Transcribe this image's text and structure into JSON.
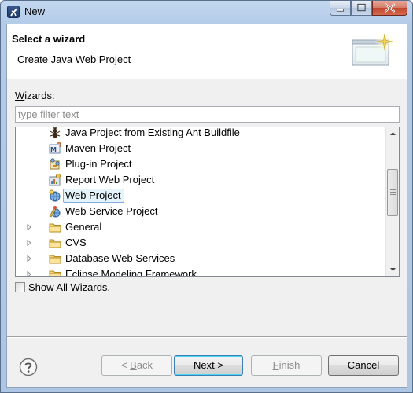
{
  "window": {
    "title": "New"
  },
  "banner": {
    "title": "Select a wizard",
    "description": "Create Java Web Project"
  },
  "wizards": {
    "label_prefix": "",
    "label_mnemonic": "W",
    "label_rest": "izards:",
    "filter_placeholder": "type filter text",
    "filter_value": ""
  },
  "tree": {
    "items": [
      {
        "label": "Java Project from Existing Ant Buildfile",
        "icon": "ant-icon",
        "indent": 1
      },
      {
        "label": "Maven Project",
        "icon": "maven-icon",
        "indent": 1
      },
      {
        "label": "Plug-in Project",
        "icon": "plugin-icon",
        "indent": 1
      },
      {
        "label": "Report Web Project",
        "icon": "report-icon",
        "indent": 1
      },
      {
        "label": "Web Project",
        "icon": "web-project-icon",
        "indent": 1,
        "selected": true
      },
      {
        "label": "Web Service Project",
        "icon": "web-service-icon",
        "indent": 1
      },
      {
        "label": "General",
        "icon": "folder-icon",
        "indent": 0,
        "expandable": true
      },
      {
        "label": "CVS",
        "icon": "folder-icon",
        "indent": 0,
        "expandable": true
      },
      {
        "label": "Database Web Services",
        "icon": "folder-icon",
        "indent": 0,
        "expandable": true
      },
      {
        "label": "Eclipse Modeling Framework",
        "icon": "folder-icon",
        "indent": 0,
        "expandable": true
      }
    ]
  },
  "show_all": {
    "mnemonic": "S",
    "rest": "how All Wizards.",
    "checked": false
  },
  "buttons": {
    "back": {
      "lead": "< ",
      "mnemonic": "B",
      "rest": "ack"
    },
    "next": "Next >",
    "finish": {
      "mnemonic": "F",
      "rest": "inish"
    },
    "cancel": "Cancel"
  },
  "colors": {
    "selection_bg": "#e5f3fb",
    "selection_border": "#84acdd",
    "folder": "#e8c15a"
  }
}
